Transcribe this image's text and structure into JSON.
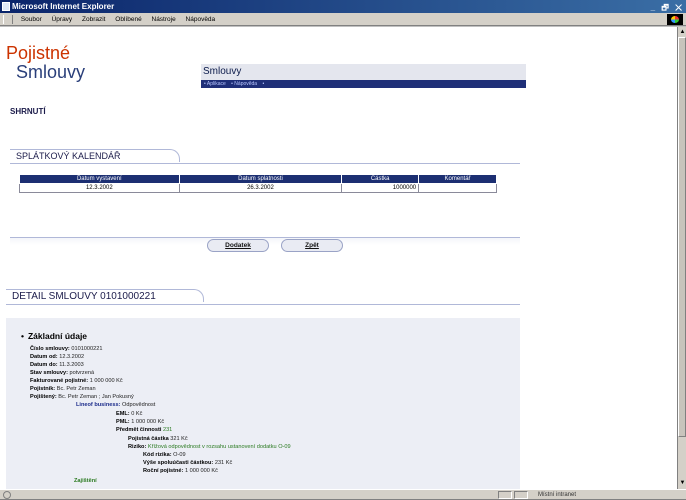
{
  "window": {
    "title": "Microsoft Internet Explorer",
    "controls": "_ 🗗 ✕"
  },
  "menu": [
    "Soubor",
    "Úpravy",
    "Zobrazit",
    "Oblíbené",
    "Nástroje",
    "Nápověda"
  ],
  "logo": {
    "line1": "Pojistné",
    "line2": "Smlouvy"
  },
  "app": {
    "title": "Smlouvy",
    "nav": [
      "• Aplikace",
      "• Nápověda",
      "•"
    ]
  },
  "summary_label": "SHRNUTÍ",
  "calendar": {
    "heading": "SPLÁTKOVÝ KALENDÁŘ",
    "columns": [
      "Datum vystavení",
      "Datum splatnosti",
      "Částka",
      "Komentář"
    ],
    "rows": [
      [
        "12.3.2002",
        "26.3.2002",
        "1000000",
        ""
      ]
    ]
  },
  "buttons": {
    "dodatek": "Dodatek",
    "zpet": "Zpět"
  },
  "detail": {
    "heading": "DETAIL SMLOUVY 0101000221",
    "section_title": "Základní údaje",
    "fields": [
      {
        "label": "Číslo smlouvy:",
        "value": "0101000221"
      },
      {
        "label": "Datum od:",
        "value": "12.3.2002"
      },
      {
        "label": "Datum do:",
        "value": "11.3.2003"
      },
      {
        "label": "Stav smlouvy:",
        "value": "potvrzená"
      },
      {
        "label": "Fakturované pojistné:",
        "value": "1 000 000 Kč"
      },
      {
        "label": "Pojistník:",
        "value": "Bc. Petr Zeman"
      },
      {
        "label": "Pojištený:",
        "value": "Bc. Petr Zeman ; Jan Pokusný"
      }
    ],
    "business": {
      "label": "Lineof business:",
      "value": "Odpovědnost"
    },
    "eml": {
      "label": "EML:",
      "value": "0 Kč"
    },
    "pml": {
      "label": "PML:",
      "value": "1 000 000 Kč"
    },
    "predmet": {
      "label": "Předmět činnosti",
      "value": "231"
    },
    "castka": {
      "label": "Pojistná částka",
      "value": "321 Kč"
    },
    "riziko": {
      "label": "Riziko:",
      "value": "Křížová odpovědnost v rozsahu ustanovení dodatku O-09"
    },
    "kod": {
      "label": "Kód rizika:",
      "value": "O-09"
    },
    "spoluucast": {
      "label": "Výše spoluúčasti částkou:",
      "value": "231 Kč"
    },
    "rocni": {
      "label": "Roční pojistné:",
      "value": "1 000 000 Kč"
    },
    "zajisteni": "Zajištění"
  },
  "status": {
    "zone": "Místní intranet"
  }
}
